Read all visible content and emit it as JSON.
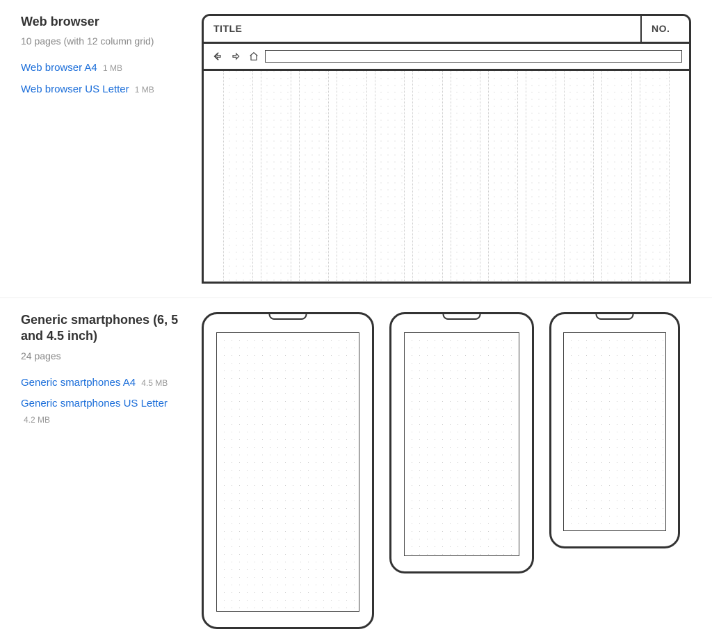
{
  "sections": [
    {
      "title": "Web browser",
      "subtitle": "10 pages (with 12 column grid)",
      "downloads": [
        {
          "label": "Web browser A4",
          "size": "1 MB"
        },
        {
          "label": "Web browser US Letter",
          "size": "1 MB"
        }
      ],
      "mockup": {
        "title_label": "TITLE",
        "number_label": "NO."
      }
    },
    {
      "title": "Generic smartphones (6, 5 and 4.5 inch)",
      "subtitle": "24 pages",
      "downloads": [
        {
          "label": "Generic smartphones A4",
          "size": "4.5 MB"
        },
        {
          "label": "Generic smartphones US Letter",
          "size": "4.2 MB"
        }
      ]
    }
  ]
}
